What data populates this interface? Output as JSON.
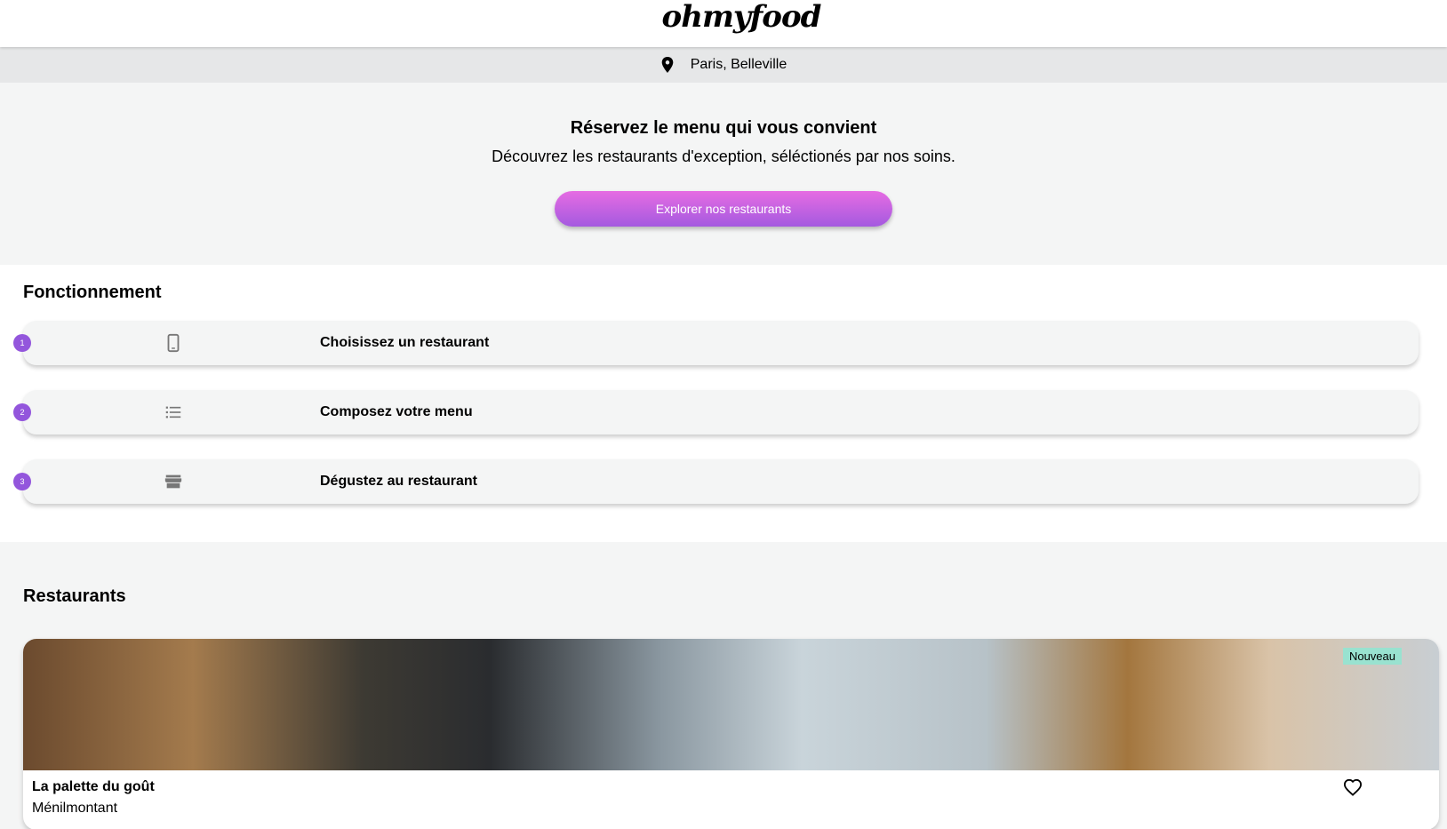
{
  "header": {
    "logo": "ohmyfood"
  },
  "location": {
    "icon": "map-pin-icon",
    "text": "Paris, Belleville"
  },
  "hero": {
    "title": "Réservez le menu qui vous convient",
    "subtitle": "Découvrez les restaurants d'exception, séléctionés par nos soins.",
    "button_label": "Explorer nos restaurants",
    "button_color_top": "#e66ce2",
    "button_color_bottom": "#a45ae0"
  },
  "how_it_works": {
    "title": "Fonctionnement",
    "steps": [
      {
        "number": "1",
        "icon": "mobile-phone-icon",
        "label": "Choisissez un restaurant"
      },
      {
        "number": "2",
        "icon": "list-icon",
        "label": "Composez votre menu"
      },
      {
        "number": "3",
        "icon": "storefront-icon",
        "label": "Dégustez au restaurant"
      }
    ]
  },
  "restaurants": {
    "title": "Restaurants",
    "items": [
      {
        "badge": "Nouveau",
        "name": "La palette du goût",
        "area": "Ménilmontant",
        "favorite_icon": "heart-outline-icon"
      }
    ]
  },
  "colors": {
    "accent": "#9356dc",
    "badge": "#99e2d0",
    "section_bg": "#f4f5f5",
    "location_bg": "#e6e7e8"
  }
}
